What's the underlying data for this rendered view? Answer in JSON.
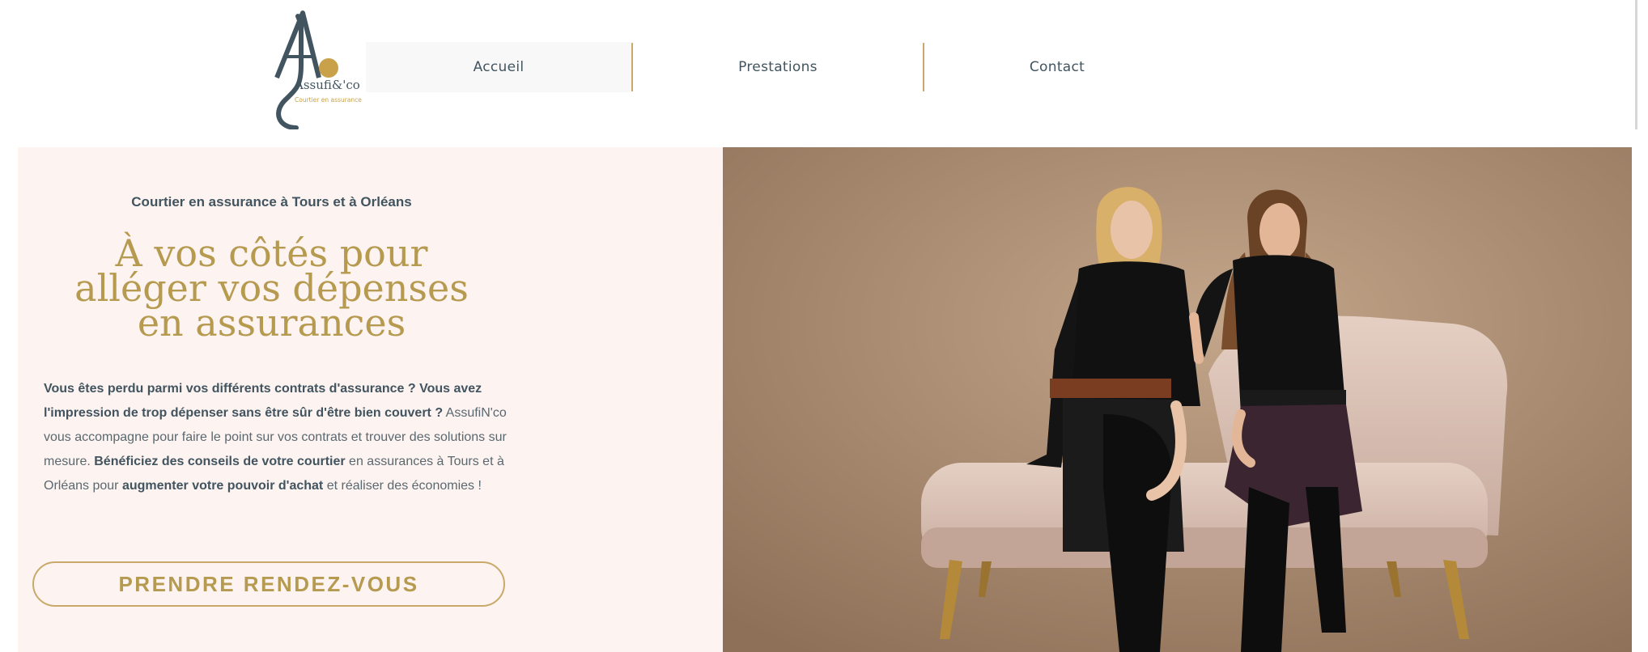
{
  "brand": {
    "logo_text": "Assufi&'co",
    "logo_tagline": "Courtier en assurance",
    "gold": "#b59a4f",
    "slate": "#41545f",
    "hero_bg": "#fdf3f0"
  },
  "nav": {
    "items": [
      {
        "label": "Accueil"
      },
      {
        "label": "Prestations"
      },
      {
        "label": "Contact"
      }
    ]
  },
  "hero": {
    "eyebrow": "Courtier en assurance à Tours et à Orléans",
    "headline": "À vos côtés pour alléger vos dépenses en assurances",
    "body": {
      "p1": "Vous êtes perdu parmi vos différents contrats d'assurance ? Vous avez l'impression de trop dépenser sans être sûr d'être bien couvert ?",
      "p2": "AssufiN'co vous accompagne pour faire le point sur vos contrats et trouver des solutions sur mesure.",
      "p3": "Bénéficiez des conseils de votre courtier",
      "p4": "en assurances à Tours et à Orléans pour",
      "p5": "augmenter votre pouvoir d'achat",
      "p6": "et réaliser des économies !"
    },
    "cta_label": "PRENDRE RENDEZ-VOUS"
  }
}
